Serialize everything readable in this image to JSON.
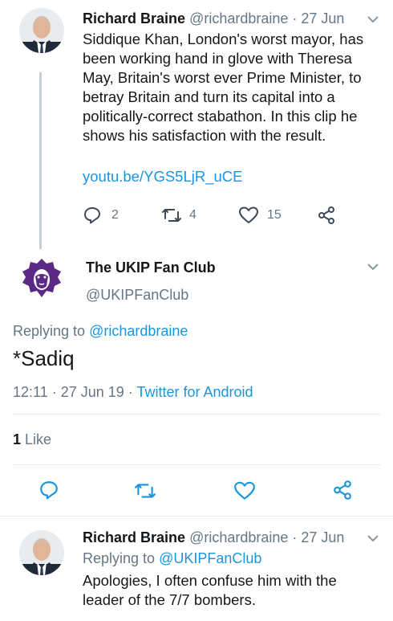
{
  "tweet1": {
    "author": "Richard Braine",
    "handle_date": "@richardbraine · 27 Jun",
    "text_lines": [
      "Siddique Khan, London's worst mayor, has",
      "been working hand in glove with Theresa",
      "May, Britain's worst ever Prime Minister, to",
      "betray Britain and turn its capital into a",
      "politically-correct stabathon. In this clip he",
      "shows his satisfaction with the result."
    ],
    "link": "youtu.be/YGS5LjR_uCE",
    "reply_count": "2",
    "retweet_count": "4",
    "like_count": "15"
  },
  "tweet2": {
    "author": "The UKIP Fan Club",
    "handle": "@UKIPFanClub",
    "replying_prefix": "Replying to ",
    "replying_handle": "@richardbraine",
    "text": "*Sadiq",
    "timestamp": "12:11 · 27 Jun 19 · ",
    "source": "Twitter for Android",
    "likes_number": "1",
    "likes_label": " Like"
  },
  "tweet3": {
    "author": "Richard Braine",
    "handle_date": "@richardbraine · 27 Jun",
    "replying_prefix": "Replying to ",
    "replying_handle": "@UKIPFanClub",
    "text_lines": [
      "Apologies, I often confuse him with the",
      "leader of the 7/7 bombers."
    ]
  },
  "icons": {
    "caret": "chevron-down-icon",
    "reply": "reply-icon",
    "retweet": "retweet-icon",
    "like": "heart-icon",
    "share": "share-icon"
  },
  "colors": {
    "link": "#1b95e0",
    "muted": "#657786",
    "ukip_purple": "#5b2a86",
    "thread_line": "#c3cfd9"
  }
}
